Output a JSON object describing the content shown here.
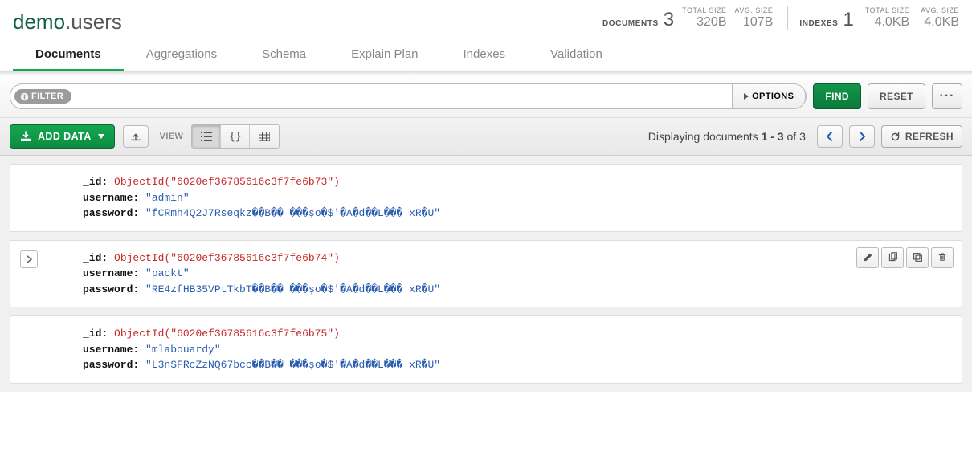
{
  "header": {
    "db": "demo",
    "collection": "users",
    "documents_label": "DOCUMENTS",
    "documents_count": "3",
    "indexes_label": "INDEXES",
    "indexes_count": "1",
    "doc_total_size_label": "TOTAL SIZE",
    "doc_total_size": "320B",
    "doc_avg_size_label": "AVG. SIZE",
    "doc_avg_size": "107B",
    "idx_total_size_label": "TOTAL SIZE",
    "idx_total_size": "4.0KB",
    "idx_avg_size_label": "AVG. SIZE",
    "idx_avg_size": "4.0KB"
  },
  "tabs": {
    "documents": "Documents",
    "aggregations": "Aggregations",
    "schema": "Schema",
    "explain": "Explain Plan",
    "indexes": "Indexes",
    "validation": "Validation"
  },
  "filter": {
    "tag": "FILTER",
    "value": "",
    "options": "OPTIONS",
    "find": "FIND",
    "reset": "RESET"
  },
  "toolbar": {
    "add_data": "ADD DATA",
    "view": "VIEW",
    "paging_prefix": "Displaying documents ",
    "paging_range": "1 - 3",
    "paging_mid": " of ",
    "paging_total": "3",
    "refresh": "REFRESH"
  },
  "docs": [
    {
      "id": "ObjectId(\"6020ef36785616c3f7fe6b73\")",
      "username": "\"admin\"",
      "password": "\"fCRmh4Q2J7Rseqkz��B�� ���șo�$'�A�d��L��� xR�U\""
    },
    {
      "id": "ObjectId(\"6020ef36785616c3f7fe6b74\")",
      "username": "\"packt\"",
      "password": "\"RE4zfHB35VPtTkbT��B�� ���șo�$'�A�d��L��� xR�U\""
    },
    {
      "id": "ObjectId(\"6020ef36785616c3f7fe6b75\")",
      "username": "\"mlabouardy\"",
      "password": "\"L3nSFRcZzNQ67bcc��B�� ���șo�$'�A�d��L��� xR�U\""
    }
  ],
  "keys": {
    "id": "_id:",
    "username": "username:",
    "password": "password:"
  }
}
